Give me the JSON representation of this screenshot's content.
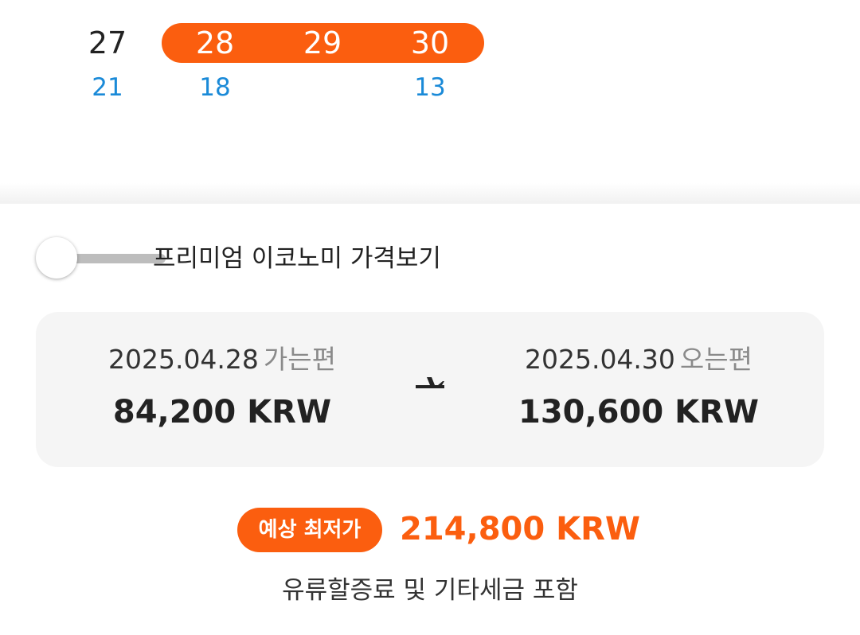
{
  "calendar": {
    "range_color": "#fb5e0f",
    "price_color": "#1a8ad8",
    "days": [
      {
        "day": "27",
        "price": "21"
      },
      {
        "day": "28",
        "price": "18"
      },
      {
        "day": "29",
        "price": ""
      },
      {
        "day": "30",
        "price": "13"
      }
    ]
  },
  "premium_toggle": {
    "label": "프리미엄 이코노미 가격보기",
    "state": "off"
  },
  "fare": {
    "departure": {
      "date": "2025.04.28",
      "type": "가는편",
      "price": "84,200 KRW"
    },
    "return": {
      "date": "2025.04.30",
      "type": "오는편",
      "price": "130,600 KRW"
    },
    "icon": "airplane-icon"
  },
  "lowest": {
    "badge": "예상 최저가",
    "price": "214,800 KRW",
    "note": "유류할증료 및 기타세금 포함"
  }
}
